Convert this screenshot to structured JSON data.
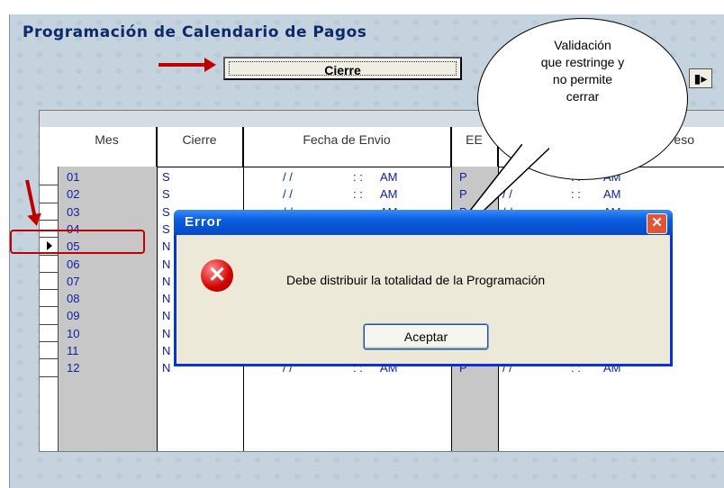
{
  "window": {
    "title": "Programación de Calendario de Pagos"
  },
  "toolbar": {
    "cierre_label": "Cierre",
    "exit_icon": "exit-door-icon"
  },
  "grid": {
    "headers": [
      "Mes",
      "Cierre",
      "Fecha de Envio",
      "EE",
      "Fecha de Ingreso"
    ],
    "header_visible_tail": "eso",
    "rows": [
      {
        "mes": "01",
        "cierre": "S",
        "fecha": "/ /",
        "hora": ": :",
        "ampm": "AM",
        "ee": "P",
        "fecha2": "",
        "hora2": ": :",
        "ampm2": "AM"
      },
      {
        "mes": "02",
        "cierre": "S",
        "fecha": "/ /",
        "hora": ": :",
        "ampm": "AM",
        "ee": "P",
        "fecha2": "/ /",
        "hora2": ": :",
        "ampm2": "AM"
      },
      {
        "mes": "03",
        "cierre": "S",
        "fecha": "/ /",
        "hora": ": :",
        "ampm": "AM",
        "ee": "P",
        "fecha2": "/ /",
        "hora2": ": :",
        "ampm2": "AM"
      },
      {
        "mes": "04",
        "cierre": "S"
      },
      {
        "mes": "05",
        "cierre": "N"
      },
      {
        "mes": "06",
        "cierre": "N"
      },
      {
        "mes": "07",
        "cierre": "N"
      },
      {
        "mes": "08",
        "cierre": "N"
      },
      {
        "mes": "09",
        "cierre": "N"
      },
      {
        "mes": "10",
        "cierre": "N"
      },
      {
        "mes": "11",
        "cierre": "N"
      },
      {
        "mes": "12",
        "cierre": "N",
        "fecha": "/ /",
        "hora": ": :",
        "ampm": "AM",
        "ee": "P",
        "fecha2": "/ /",
        "hora2": ": :",
        "ampm2": "AM"
      }
    ]
  },
  "dialog": {
    "title": "Error",
    "message": "Debe distribuir la totalidad de la Programación",
    "button_label": "Aceptar",
    "close_glyph": "✕"
  },
  "callout": {
    "lines": [
      "Validación",
      "que restringe y",
      "no permite",
      "cerrar"
    ]
  },
  "colors": {
    "annotation_red": "#c00000",
    "dialog_blue": "#0831d9",
    "grid_text": "#1020a0"
  }
}
